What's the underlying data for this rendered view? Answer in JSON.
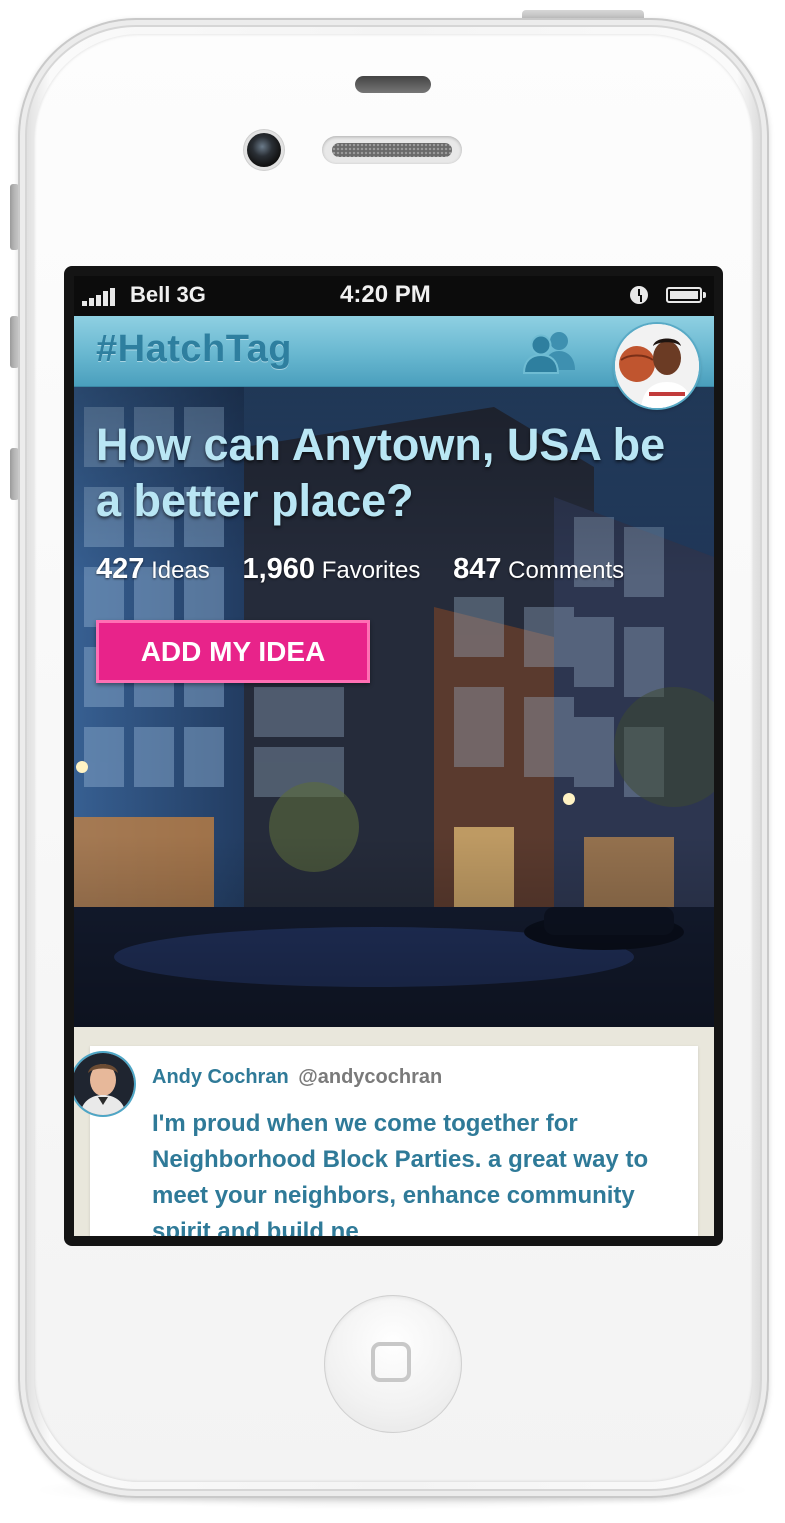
{
  "status_bar": {
    "carrier": "Bell",
    "network": "3G",
    "time": "4:20 PM"
  },
  "nav": {
    "brand": "#HatchTag",
    "people_icon": "people-icon",
    "avatar_icon": "user-avatar"
  },
  "hero": {
    "question": "How can Anytown, USA be a better place?",
    "stats": [
      {
        "value": "427",
        "label": "Ideas"
      },
      {
        "value": "1,960",
        "label": "Favorites"
      },
      {
        "value": "847",
        "label": "Comments"
      }
    ],
    "cta_label": "ADD MY IDEA"
  },
  "feed": [
    {
      "author_name": "Andy Cochran",
      "author_handle": "@andycochran",
      "text": "I'm proud when we come together for Neighborhood Block Parties. a great way to meet your neighbors, enhance community spirit and build ne"
    }
  ],
  "colors": {
    "accent": "#68b7d0",
    "brand_text": "#2e7f9f",
    "cta": "#e8238a",
    "feed_text": "#2f7a98"
  }
}
